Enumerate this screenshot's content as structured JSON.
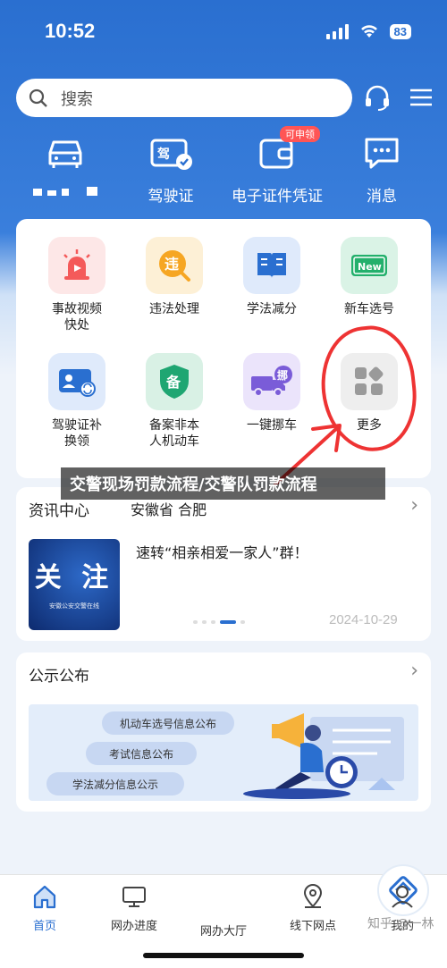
{
  "status": {
    "time": "10:52",
    "battery": "83"
  },
  "search": {
    "placeholder": "搜索"
  },
  "quick": [
    {
      "label": "",
      "icon": "car-icon"
    },
    {
      "label": "驾驶证",
      "icon": "license-icon"
    },
    {
      "label": "电子证件凭证",
      "icon": "wallet-icon",
      "badge": "可申领"
    },
    {
      "label": "消息",
      "icon": "message-icon"
    }
  ],
  "services": [
    {
      "label": "事故视频\n快处",
      "icon": "siren-icon",
      "color": "#f45a5a"
    },
    {
      "label": "违法处理",
      "icon": "violation-icon",
      "color": "#f6a623",
      "glyph": "违"
    },
    {
      "label": "学法减分",
      "icon": "book-icon",
      "color": "#2a6fd0"
    },
    {
      "label": "新车选号",
      "icon": "plate-icon",
      "color": "#23b06c",
      "glyph": "New"
    },
    {
      "label": "驾驶证补\n换领",
      "icon": "id-card-icon",
      "color": "#2a6fd0"
    },
    {
      "label": "备案非本\n人机动车",
      "icon": "shield-icon",
      "color": "#1fa672",
      "glyph": "备"
    },
    {
      "label": "一键挪车",
      "icon": "truck-icon",
      "color": "#7a5cd8",
      "glyph": "挪"
    },
    {
      "label": "更多",
      "icon": "more-icon",
      "color": "#9a9a9a"
    }
  ],
  "banner": {
    "text": "交警现场罚款流程/交警队罚款流程"
  },
  "news": {
    "title": "资讯中心",
    "region": "安徽省 合肥",
    "image_text": "关 注",
    "image_sub": "安徽公安交警在线",
    "headline": "速转“相亲相爱一家人”群！",
    "date": "2024-10-29"
  },
  "notice": {
    "title": "公示公布",
    "pills": [
      "机动车选号信息公布",
      "考试信息公布",
      "学法减分信息公示"
    ]
  },
  "tabs": [
    {
      "label": "首页",
      "icon": "home-icon"
    },
    {
      "label": "网办进度",
      "icon": "monitor-icon"
    },
    {
      "label": "网办大厅",
      "icon": "hall-icon"
    },
    {
      "label": "线下网点",
      "icon": "location-icon"
    },
    {
      "label": "我的",
      "icon": "user-icon"
    }
  ],
  "watermark": "知乎 @一林",
  "colors": {
    "primary": "#2a6fd0",
    "annotation": "#e33333"
  }
}
